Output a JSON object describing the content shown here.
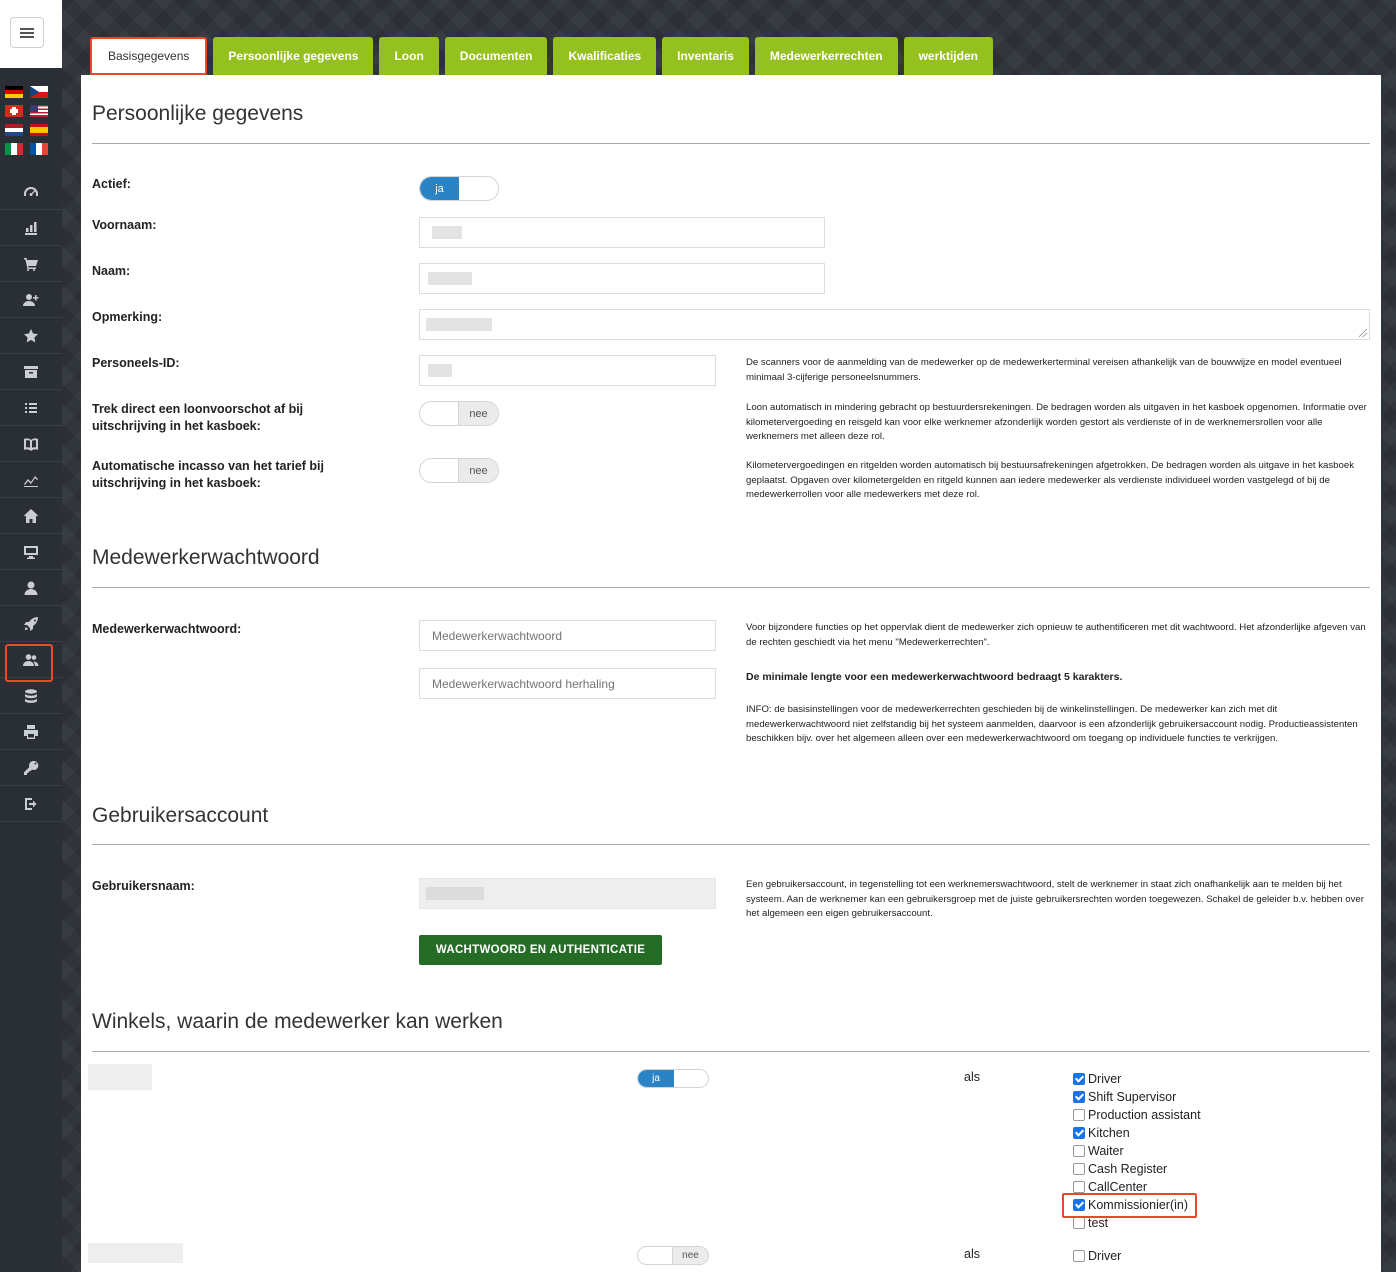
{
  "sidebar": {
    "flags": [
      {
        "icon": "flag-de-icon"
      },
      {
        "icon": "flag-cz-icon"
      },
      {
        "icon": "flag-ch-icon"
      },
      {
        "icon": "flag-us-icon"
      },
      {
        "icon": "flag-nl-icon"
      },
      {
        "icon": "flag-es-icon"
      },
      {
        "icon": "flag-it-icon"
      },
      {
        "icon": "flag-fr-icon"
      }
    ],
    "nav": [
      {
        "icon": "dashboard-icon"
      },
      {
        "icon": "bar-chart-icon"
      },
      {
        "icon": "cart-icon"
      },
      {
        "icon": "user-plus-icon"
      },
      {
        "icon": "star-icon"
      },
      {
        "icon": "archive-icon"
      },
      {
        "icon": "list-icon"
      },
      {
        "icon": "book-icon"
      },
      {
        "icon": "line-chart-icon"
      },
      {
        "icon": "home-icon"
      },
      {
        "icon": "monitor-icon"
      },
      {
        "icon": "user-icon"
      },
      {
        "icon": "rocket-icon"
      },
      {
        "icon": "users-icon",
        "active": true
      },
      {
        "icon": "database-icon"
      },
      {
        "icon": "printer-icon"
      },
      {
        "icon": "key-icon"
      },
      {
        "icon": "logout-icon"
      }
    ],
    "accent": "#e8492a"
  },
  "tabs": [
    {
      "label": "Basisgegevens",
      "active": true
    },
    {
      "label": "Persoonlijke gegevens"
    },
    {
      "label": "Loon"
    },
    {
      "label": "Documenten"
    },
    {
      "label": "Kwalificaties"
    },
    {
      "label": "Inventaris"
    },
    {
      "label": "Medewerkerrechten"
    },
    {
      "label": "werktijden"
    }
  ],
  "colors": {
    "tab_green": "#95c11f",
    "toggle_blue": "#2a83c5",
    "button_green": "#256d26",
    "highlight": "#e8492a"
  },
  "personal": {
    "title": "Persoonlijke gegevens",
    "active_label": "Actief:",
    "active_on": "ja",
    "firstname_label": "Voornaam:",
    "name_label": "Naam:",
    "remark_label": "Opmerking:",
    "staffid_label": "Personeels-ID:",
    "staffid_help": "De scanners voor de aanmelding van de medewerker op de medewerkerterminal vereisen afhankelijk van de bouwwijze en model eventueel minimaal 3-cijferige personeelsnummers.",
    "advance_label": "Trek direct een loonvoorschot af bij uitschrijving in het kasboek:",
    "advance_off": "nee",
    "advance_help": "Loon automatisch in mindering gebracht op bestuurdersrekeningen. De bedragen worden als uitgaven in het kasboek opgenomen. Informatie over kilometervergoeding en reisgeld kan voor elke werknemer afzonderlijk worden gestort als verdienste of in de werknemersrollen voor alle werknemers met alleen deze rol.",
    "collection_label": "Automatische incasso van het tarief bij uitschrijving in het kasboek:",
    "collection_off": "nee",
    "collection_help": "Kilometervergoedingen en ritgelden worden automatisch bij bestuursafrekeningen afgetrokken. De bedragen worden als uitgave in het kasboek geplaatst. Opgaven over kilometergelden en ritgeld kunnen aan iedere medewerker als verdienste individueel worden vastgelegd of bij de medewerkerrollen voor alle medewerkers met deze rol."
  },
  "password": {
    "title": "Medewerkerwachtwoord",
    "label": "Medewerkerwachtwoord:",
    "placeholder": "Medewerkerwachtwoord",
    "repeat_placeholder": "Medewerkerwachtwoord herhaling",
    "help1": "Voor bijzondere functies op het oppervlak dient de medewerker zich opnieuw te authentificeren met dit wachtwoord. Het afzonderlijke afgeven van de rechten geschiedt via het menu \"Medewerkerrechten\".",
    "help2": "De minimale lengte voor een medewerkerwachtwoord bedraagt 5 karakters.",
    "help3": "INFO: de basisinstellingen voor de medewerkerrechten geschieden bij de winkelinstellingen. De medewerker kan zich met dit medewerkerwachtwoord niet zelfstandig bij het systeem aanmelden, daarvoor is een afzonderlijk gebruikersaccount nodig. Productieassistenten beschikken bijv. over het algemeen alleen over een medewerkerwachtwoord om toegang op individuele functies te verkrijgen."
  },
  "account": {
    "title": "Gebruikersaccount",
    "username_label": "Gebruikersnaam:",
    "help": "Een gebruikersaccount, in tegenstelling tot een werknemerswachtwoord, stelt de werknemer in staat zich onafhankelijk aan te melden bij het systeem. Aan de werknemer kan een gebruikersgroep met de juiste gebruikersrechten worden toegewezen. Schakel de geleider b.v. hebben over het algemeen een eigen gebruikersaccount.",
    "button": "WACHTWOORD EN AUTHENTICATIE"
  },
  "stores": {
    "title": "Winkels, waarin de medewerker kan werken",
    "as_label": "als",
    "store1": {
      "toggle": "ja",
      "roles": [
        {
          "label": "Driver",
          "checked": true
        },
        {
          "label": "Shift Supervisor",
          "checked": true
        },
        {
          "label": "Production assistant",
          "checked": false
        },
        {
          "label": "Kitchen",
          "checked": true
        },
        {
          "label": "Waiter",
          "checked": false
        },
        {
          "label": "Cash Register",
          "checked": false
        },
        {
          "label": "CallCenter",
          "checked": false
        },
        {
          "label": "Kommissionier(in)",
          "checked": true,
          "highlighted": true
        },
        {
          "label": "test",
          "checked": false
        }
      ]
    },
    "store2": {
      "toggle": "nee",
      "roles": [
        {
          "label": "Driver",
          "checked": false
        }
      ]
    }
  }
}
